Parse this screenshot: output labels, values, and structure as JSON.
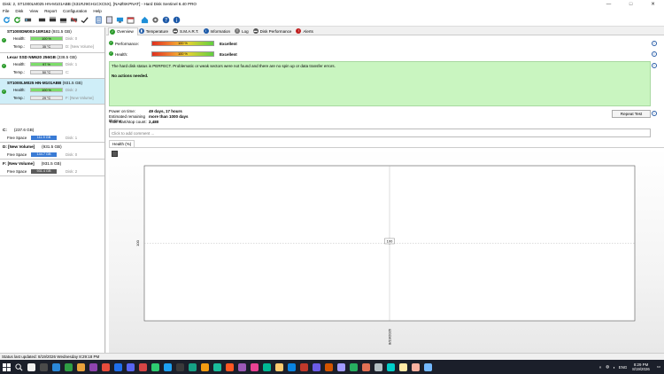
{
  "window": {
    "title": "Disk: 2, ST1000LM025 HN-M101ABB (S31RJ9GH1CXC5X), [NAØSKPNAT] - Hard Disk Sentinel 6.40 PRO",
    "minimize": "—",
    "maximize": "□",
    "close": "✕"
  },
  "menu": [
    "File",
    "Disk",
    "View",
    "Report",
    "Configuration",
    "Help"
  ],
  "disks": [
    {
      "name": "ST1000DM003-1ER162",
      "capacity": "(931.5 GB)",
      "health_label": "Health:",
      "health": "100 %",
      "health_pct": 100,
      "health_side": "Disk: 0",
      "temp_label": "Temp.:",
      "temp": "35 °C",
      "temp_side": "D: [New Volume]",
      "selected": false
    },
    {
      "name": "Lexar SSD NM620 256GB",
      "capacity": "(238.5 GB)",
      "health_label": "Health:",
      "health": "97 %",
      "health_pct": 97,
      "health_side": "Disk: 1",
      "temp_label": "Temp.:",
      "temp": "50 °C",
      "temp_side": "C:",
      "selected": false
    },
    {
      "name": "ST1000LM025 HN-M101ABB",
      "capacity": "(931.5 GB)",
      "health_label": "Health:",
      "health": "100 %",
      "health_pct": 100,
      "health_side": "Disk: 2",
      "temp_label": "Temp.:",
      "temp": "29 °C",
      "temp_side": "F: [New Volume]",
      "selected": true
    }
  ],
  "volumes": [
    {
      "name": "C:",
      "capacity": "(237.6 GB)",
      "free_label": "Free Space",
      "free": "111.9 GB",
      "side": "Disk: 1",
      "color": "#3a7bd5"
    },
    {
      "name": "D: [New Volume]",
      "capacity": "(931.5 GB)",
      "free_label": "Free Space",
      "free": "144.7 GB",
      "side": "Disk: 0",
      "color": "#3a7bd5"
    },
    {
      "name": "F: [New Volume]",
      "capacity": "(931.5 GB)",
      "free_label": "Free Space",
      "free": "931.4 GB",
      "side": "Disk: 2",
      "color": "#5a5a5a"
    }
  ],
  "tabs": [
    {
      "label": "Overview",
      "icon": "check-icon",
      "color": "#2a9a2a",
      "active": true
    },
    {
      "label": "Temperature",
      "icon": "thermometer-icon",
      "color": "#1e5aa8",
      "active": false
    },
    {
      "label": "S.M.A.R.T.",
      "icon": "smart-icon",
      "color": "#555555",
      "active": false
    },
    {
      "label": "Information",
      "icon": "info-icon",
      "color": "#1e5aa8",
      "active": false
    },
    {
      "label": "Log",
      "icon": "log-icon",
      "color": "#777777",
      "active": false
    },
    {
      "label": "Disk Performance",
      "icon": "performance-icon",
      "color": "#555555",
      "active": false
    },
    {
      "label": "Alerts",
      "icon": "alert-icon",
      "color": "#c02020",
      "active": false
    }
  ],
  "overview": {
    "performance_label": "Performance:",
    "performance_value": "100 %",
    "performance_word": "Excellent",
    "health_label": "Health:",
    "health_value": "100 %",
    "health_word": "Excellent",
    "status_text": "The hard disk status is PERFECT. Problematic or weak sectors were not found and there are no spin up or data transfer errors.",
    "actions_text": "No actions needed.",
    "power_on_label": "Power on time:",
    "power_on_value": "49 days, 17 hours",
    "remaining_label": "Estimated remaining lifetime:",
    "remaining_value": "more than 1000 days",
    "startstop_label": "Total start/stop count:",
    "startstop_value": "2,480",
    "repeat_button": "Repeat Test",
    "comment_placeholder": "Click to add comment ...",
    "health_tab": "Health (%)"
  },
  "chart_data": {
    "type": "line",
    "title": "",
    "x": [
      "8/19/2026"
    ],
    "series": [
      {
        "values": [
          100
        ]
      }
    ],
    "ylabel_tick": "100",
    "point_label": "100",
    "xlabel": "",
    "ylabel": "",
    "grid": "crosshair"
  },
  "statusbar": {
    "text": "Status last updated: 8/19/2026 Wednesday 8:29:18 PM"
  },
  "taskbar": {
    "apps": [
      "#f0f0f0",
      "#4a4a4a",
      "#2b88d8",
      "#2f9e44",
      "#e9a23b",
      "#8e44ad",
      "#e74c3c",
      "#1f6feb",
      "#5865f2",
      "#d64545",
      "#2ecc71",
      "#1da1f2",
      "#3a3a3a",
      "#16a085",
      "#f39c12",
      "#1abc9c",
      "#ff5722",
      "#9b59b6",
      "#e84393",
      "#00b894",
      "#fdcb6e",
      "#0984e3",
      "#c0392b",
      "#6c5ce7",
      "#d35400",
      "#a29bfe",
      "#27ae60",
      "#e17055",
      "#b2bec3",
      "#00cec9",
      "#ffeaa7",
      "#fab1a0",
      "#74b9ff"
    ],
    "lang": "ENG",
    "time": "8:29 PM",
    "date": "8/19/2026"
  }
}
